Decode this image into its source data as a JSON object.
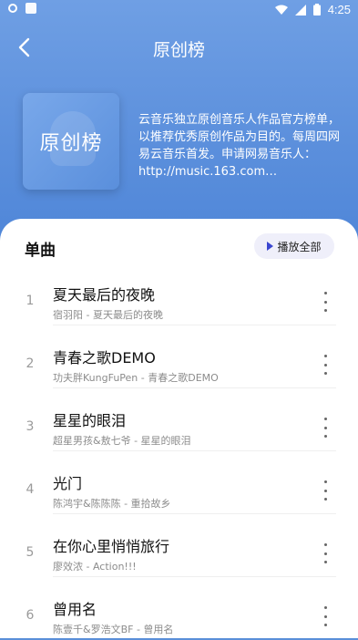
{
  "status": {
    "time": "4:25"
  },
  "header": {
    "title": "原创榜"
  },
  "cover": {
    "text": "原创榜"
  },
  "description": "云音乐独立原创音乐人作品官方榜单，以推荐优秀原创作品为目的。每周四网易云音乐首发。申请网易音乐人：http://music.163.com…",
  "section": {
    "title": "单曲",
    "play_all_label": "播放全部"
  },
  "songs": [
    {
      "rank": "1",
      "title": "夏天最后的夜晚",
      "subtitle": "宿羽阳 - 夏天最后的夜晚"
    },
    {
      "rank": "2",
      "title": "青春之歌DEMO",
      "subtitle": "功夫胖KungFuPen - 青春之歌DEMO"
    },
    {
      "rank": "3",
      "title": "星星的眼泪",
      "subtitle": "超星男孩&敖七爷 - 星星的眼泪"
    },
    {
      "rank": "4",
      "title": "光门",
      "subtitle": "陈鸿宇&陈陈陈 - 重拾故乡"
    },
    {
      "rank": "5",
      "title": "在你心里悄悄旅行",
      "subtitle": "廖效浓 - Action!!!"
    },
    {
      "rank": "6",
      "title": "曾用名",
      "subtitle": "陈壹千&罗浩文BF - 曾用名"
    }
  ],
  "colors": {
    "hero": "#5b8fdc",
    "accent": "#3a46d0",
    "chip": "#efeffa"
  },
  "icons": [
    "back-arrow-icon",
    "play-icon",
    "more-vertical-icon",
    "wifi-icon",
    "signal-icon",
    "battery-icon"
  ]
}
